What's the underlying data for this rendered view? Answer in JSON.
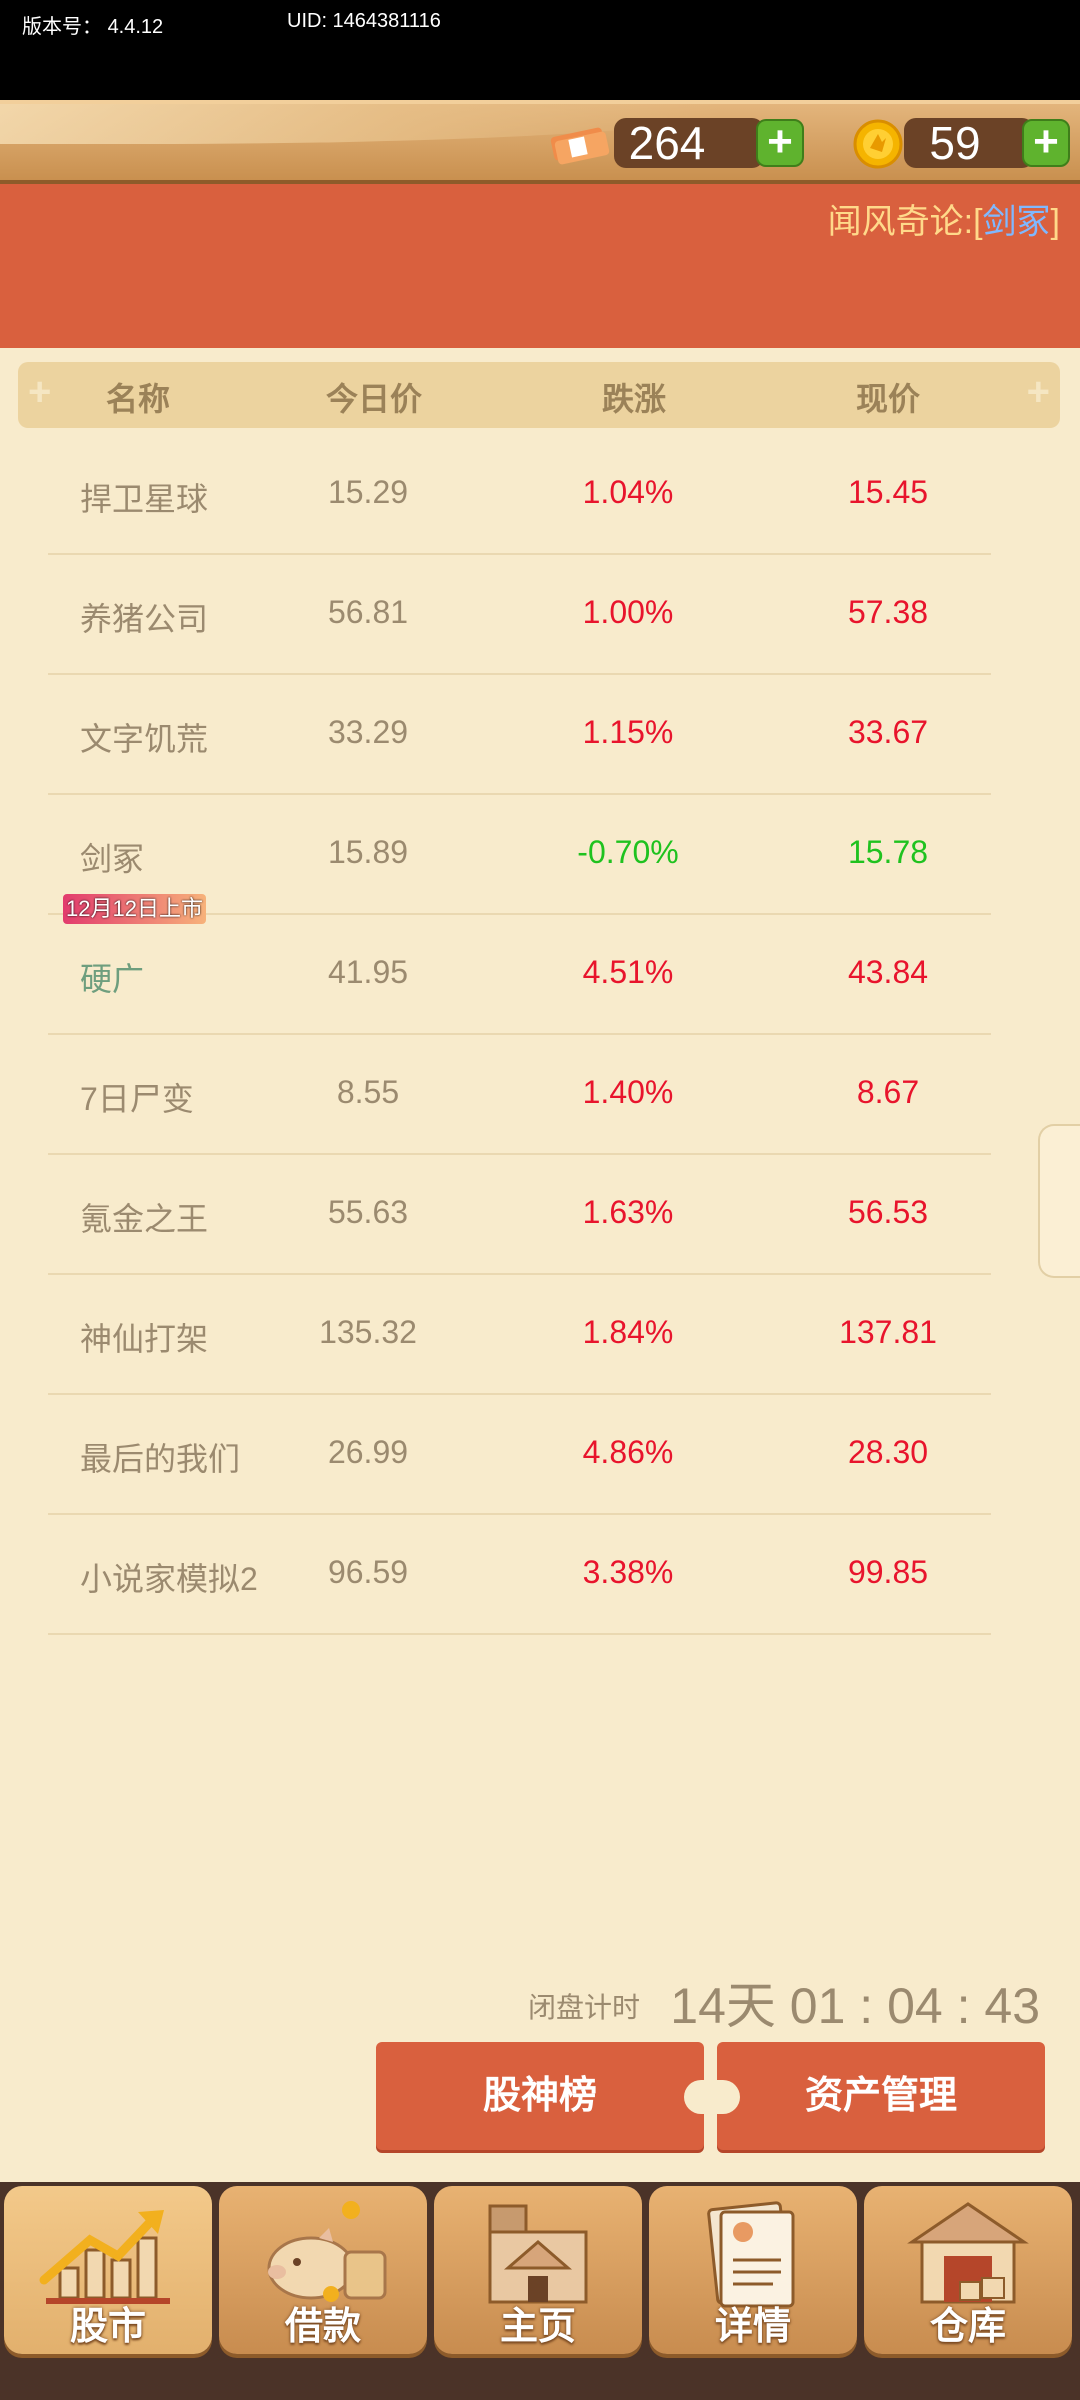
{
  "status": {
    "version_label": "版本号：",
    "version": "4.4.12",
    "uid": "UID: 1464381116"
  },
  "currency": {
    "cash": "264",
    "coins": "59"
  },
  "banner": {
    "prefix": "闻风奇论:[",
    "name": "剑冢",
    "suffix": "]"
  },
  "table": {
    "headers": [
      "名称",
      "今日价",
      "跌涨",
      "现价"
    ],
    "rows": [
      {
        "name": "捍卫星球",
        "today": "15.29",
        "change": "1.04%",
        "current": "15.45",
        "trend": "up"
      },
      {
        "name": "养猪公司",
        "today": "56.81",
        "change": "1.00%",
        "current": "57.38",
        "trend": "up"
      },
      {
        "name": "文字饥荒",
        "today": "33.29",
        "change": "1.15%",
        "current": "33.67",
        "trend": "up"
      },
      {
        "name": "剑冢",
        "today": "15.89",
        "change": "-0.70%",
        "current": "15.78",
        "trend": "down"
      },
      {
        "name": "硬广",
        "today": "41.95",
        "change": "4.51%",
        "current": "43.84",
        "trend": "up",
        "badge": "12月12日上市"
      },
      {
        "name": "7日尸变",
        "today": "8.55",
        "change": "1.40%",
        "current": "8.67",
        "trend": "up"
      },
      {
        "name": "氪金之王",
        "today": "55.63",
        "change": "1.63%",
        "current": "56.53",
        "trend": "up"
      },
      {
        "name": "神仙打架",
        "today": "135.32",
        "change": "1.84%",
        "current": "137.81",
        "trend": "up"
      },
      {
        "name": "最后的我们",
        "today": "26.99",
        "change": "4.86%",
        "current": "28.30",
        "trend": "up"
      },
      {
        "name": "小说家模拟2",
        "today": "96.59",
        "change": "3.38%",
        "current": "99.85",
        "trend": "up"
      }
    ]
  },
  "timer": {
    "label": "闭盘计时",
    "value": "14天 01 : 04 : 43"
  },
  "actions": {
    "leaderboard": "股神榜",
    "assets": "资产管理"
  },
  "nav": [
    {
      "label": "股市",
      "icon": "stock-chart-icon",
      "active": true
    },
    {
      "label": "借款",
      "icon": "piggy-bank-icon"
    },
    {
      "label": "主页",
      "icon": "house-icon"
    },
    {
      "label": "详情",
      "icon": "document-icon"
    },
    {
      "label": "仓库",
      "icon": "warehouse-icon"
    }
  ],
  "colors": {
    "up": "#e8142c",
    "down": "#1fc21f",
    "accent": "#d9603e"
  }
}
